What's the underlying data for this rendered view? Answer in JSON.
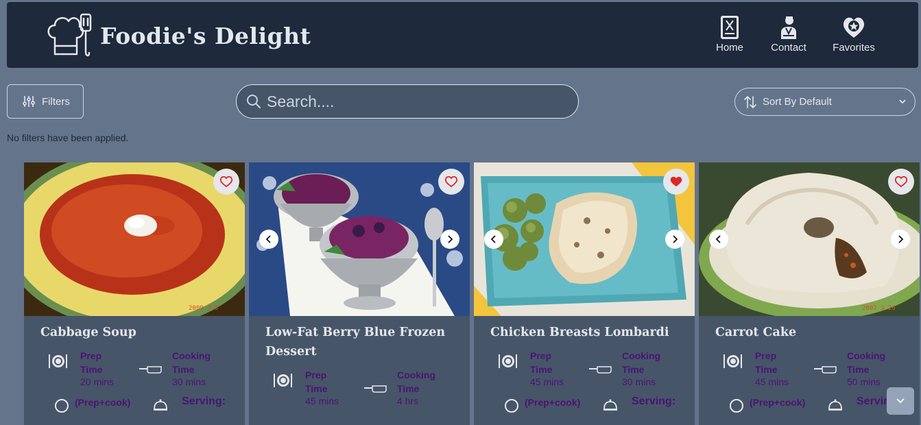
{
  "header": {
    "brand": "Foodie's Delight",
    "nav": [
      {
        "label": "Home",
        "icon": "menu-book-icon"
      },
      {
        "label": "Contact",
        "icon": "chef-person-icon"
      },
      {
        "label": "Favorites",
        "icon": "heart-star-icon"
      }
    ]
  },
  "toolbar": {
    "filters_label": "Filters",
    "search_placeholder": "Search....",
    "sort_label": "Sort By Default",
    "status": "No filters have been applied."
  },
  "labels": {
    "prep": "Prep",
    "time": "Time",
    "cooking": "Cooking",
    "prep_cook": "(Prep+cook)",
    "serving": "Serving:"
  },
  "cards": [
    {
      "title": "Cabbage Soup",
      "prep": "20 mins",
      "cook": "30 mins",
      "favorited": false,
      "image_caption": "2009 2 5"
    },
    {
      "title": "Low-Fat Berry Blue Frozen Dessert",
      "prep": "45 mins",
      "cook": "4 hrs",
      "favorited": false
    },
    {
      "title": "Chicken Breasts Lombardi",
      "prep": "45 mins",
      "cook": "30 mins",
      "favorited": true
    },
    {
      "title": "Carrot Cake",
      "prep": "45 mins",
      "cook": "50 mins",
      "favorited": false,
      "image_caption": "2007 3 26"
    }
  ],
  "colors": {
    "background": "#64748b",
    "header": "#1e293b",
    "card": "#475569",
    "stat_text": "#4a1472",
    "heart": "#dc2626"
  }
}
